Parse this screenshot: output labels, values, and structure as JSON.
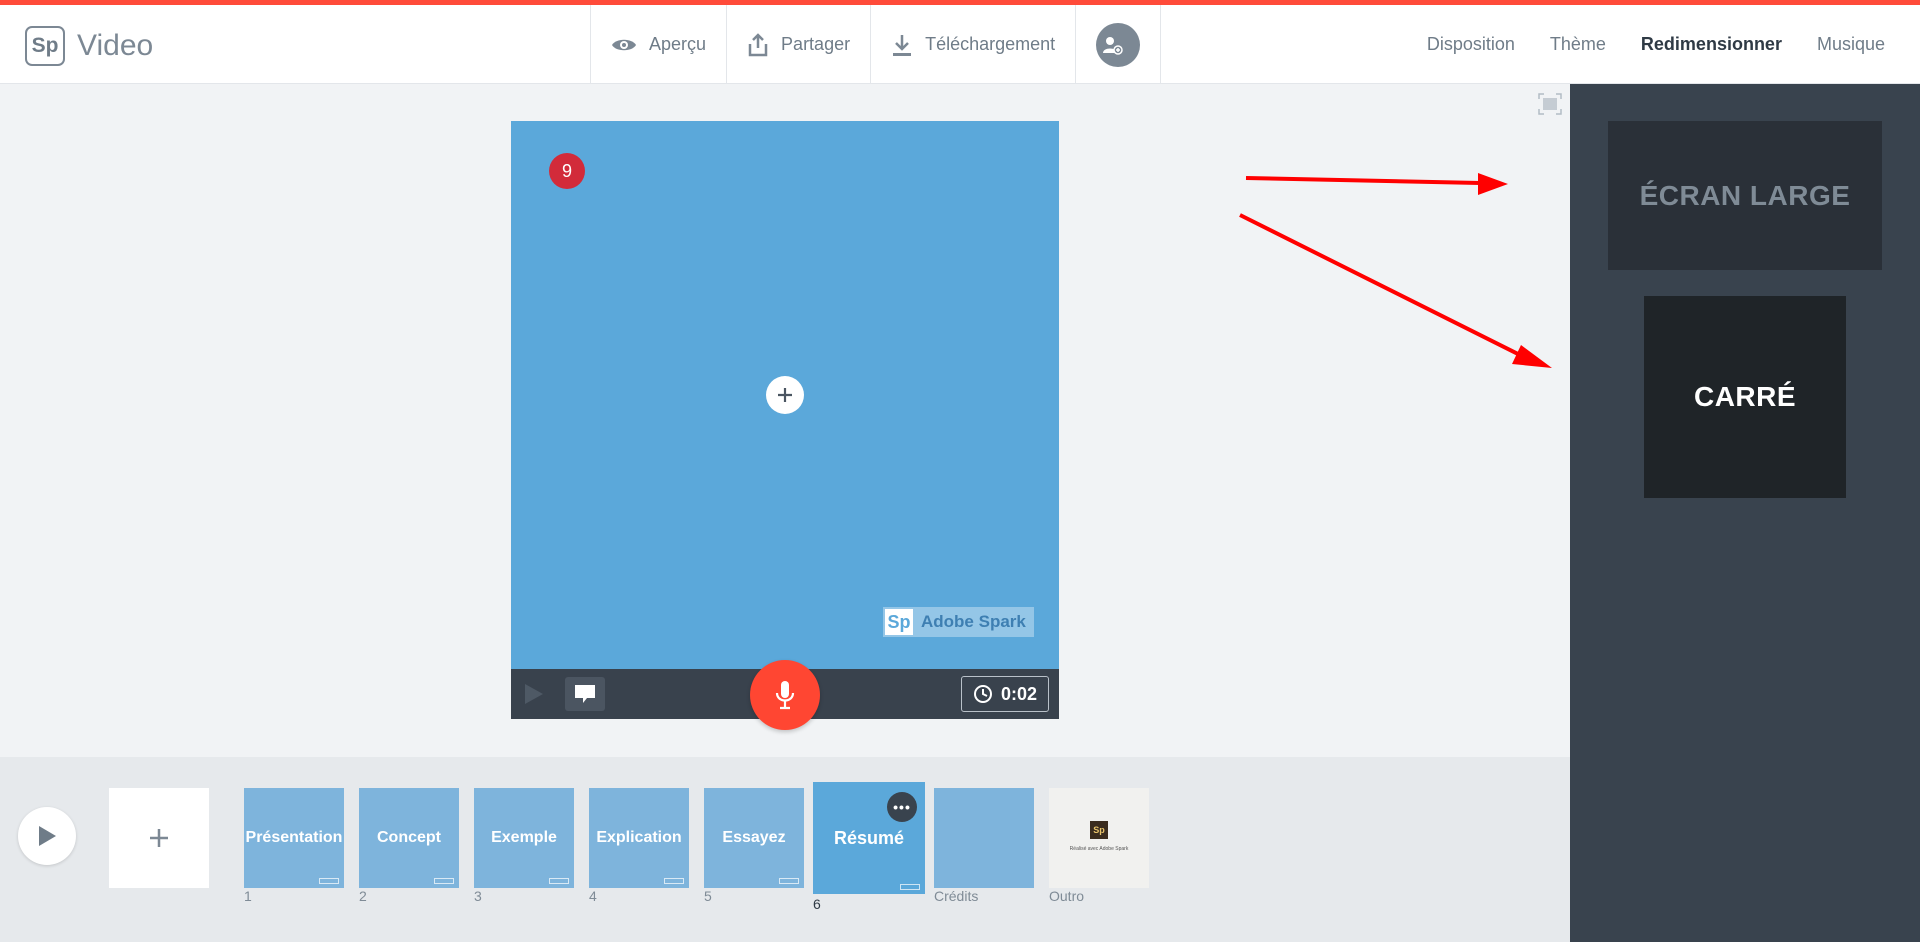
{
  "header": {
    "logo_mark": "Sp",
    "app_name": "Video",
    "actions": {
      "preview": "Aperçu",
      "share": "Partager",
      "download": "Téléchargement"
    },
    "nav": {
      "layout": "Disposition",
      "theme": "Thème",
      "resize": "Redimensionner",
      "music": "Musique"
    },
    "active_nav": "Redimensionner"
  },
  "canvas": {
    "slide_badge": "9",
    "watermark_mark": "Sp",
    "watermark_text": "Adobe Spark",
    "background_color": "#5ba8da"
  },
  "controls": {
    "timer": "0:02"
  },
  "resize_panel": {
    "wide_label": "ÉCRAN LARGE",
    "square_label": "CARRÉ",
    "selected": "CARRÉ"
  },
  "timeline": {
    "slides": [
      {
        "title": "Présentation",
        "number": "1"
      },
      {
        "title": "Concept",
        "number": "2"
      },
      {
        "title": "Exemple",
        "number": "3"
      },
      {
        "title": "Explication",
        "number": "4"
      },
      {
        "title": "Essayez",
        "number": "5"
      },
      {
        "title": "Résumé",
        "number": "6"
      },
      {
        "title": "",
        "number": "Crédits"
      }
    ],
    "outro": {
      "mark": "Sp",
      "text": "Réalisé avec Adobe Spark",
      "label": "Outro"
    },
    "more_glyph": "•••"
  },
  "colors": {
    "accent": "#ff4b3a",
    "panel": "#39434e",
    "annotation_arrow": "#ff0000"
  }
}
